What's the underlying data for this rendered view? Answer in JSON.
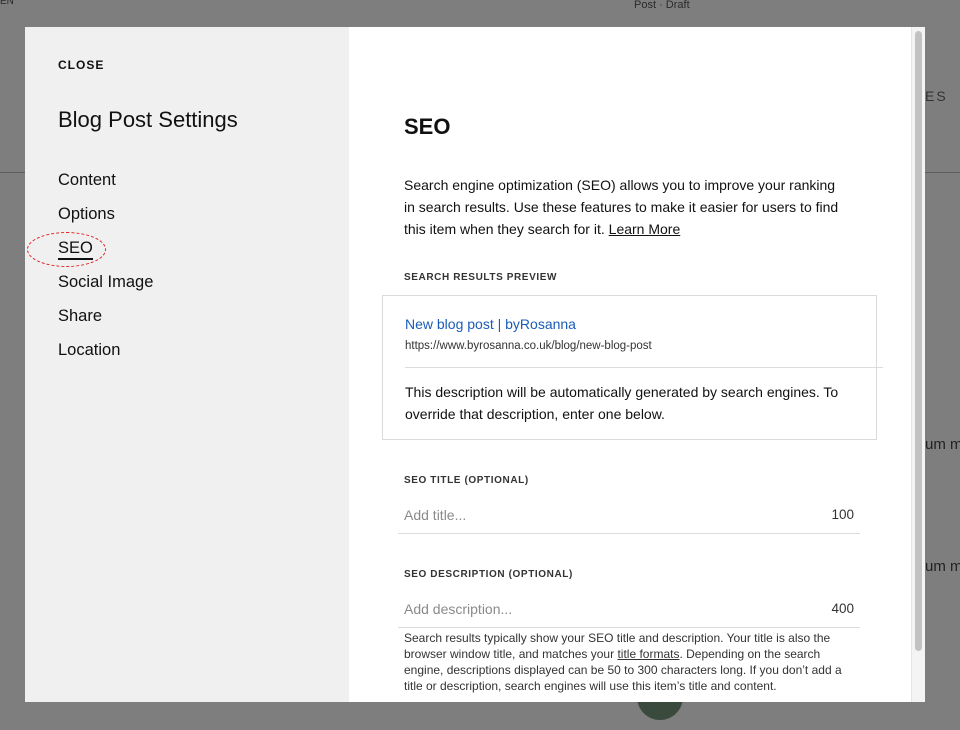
{
  "background": {
    "corner_text": "EN",
    "status": "Post · Draft",
    "nav_fragment": "ES",
    "text_fragment_1": "um m",
    "text_fragment_2": "um m"
  },
  "sidebar": {
    "close_label": "CLOSE",
    "title": "Blog Post Settings",
    "items": [
      {
        "label": "Content"
      },
      {
        "label": "Options"
      },
      {
        "label": "SEO"
      },
      {
        "label": "Social Image"
      },
      {
        "label": "Share"
      },
      {
        "label": "Location"
      }
    ],
    "active_item": "SEO",
    "annotation_color": "#e02020"
  },
  "content": {
    "title": "SEO",
    "description": "Search engine optimization (SEO) allows you to improve your ranking in search results. Use these features to make it easier for users to find this item when they search for it.",
    "learn_more": "Learn More",
    "preview_label": "SEARCH RESULTS PREVIEW",
    "preview": {
      "link_title": "New blog post | byRosanna",
      "url": "https://www.byrosanna.co.uk/blog/new-blog-post",
      "text": "This description will be automatically generated by search engines. To override that description, enter one below.",
      "link_color": "#1a5db8"
    },
    "seo_title": {
      "label": "SEO TITLE (OPTIONAL)",
      "placeholder": "Add title...",
      "value": "",
      "count": "100"
    },
    "seo_description": {
      "label": "SEO DESCRIPTION (OPTIONAL)",
      "placeholder": "Add description...",
      "value": "",
      "count": "400"
    },
    "help": {
      "before_link": "Search results typically show your SEO title and description. Your title is also the browser window title, and matches your ",
      "link": "title formats",
      "after_link": ". Depending on the search engine, descriptions displayed can be 50 to 300 characters long. If you don’t add a title or description, search engines will use this item’s title and content."
    }
  }
}
